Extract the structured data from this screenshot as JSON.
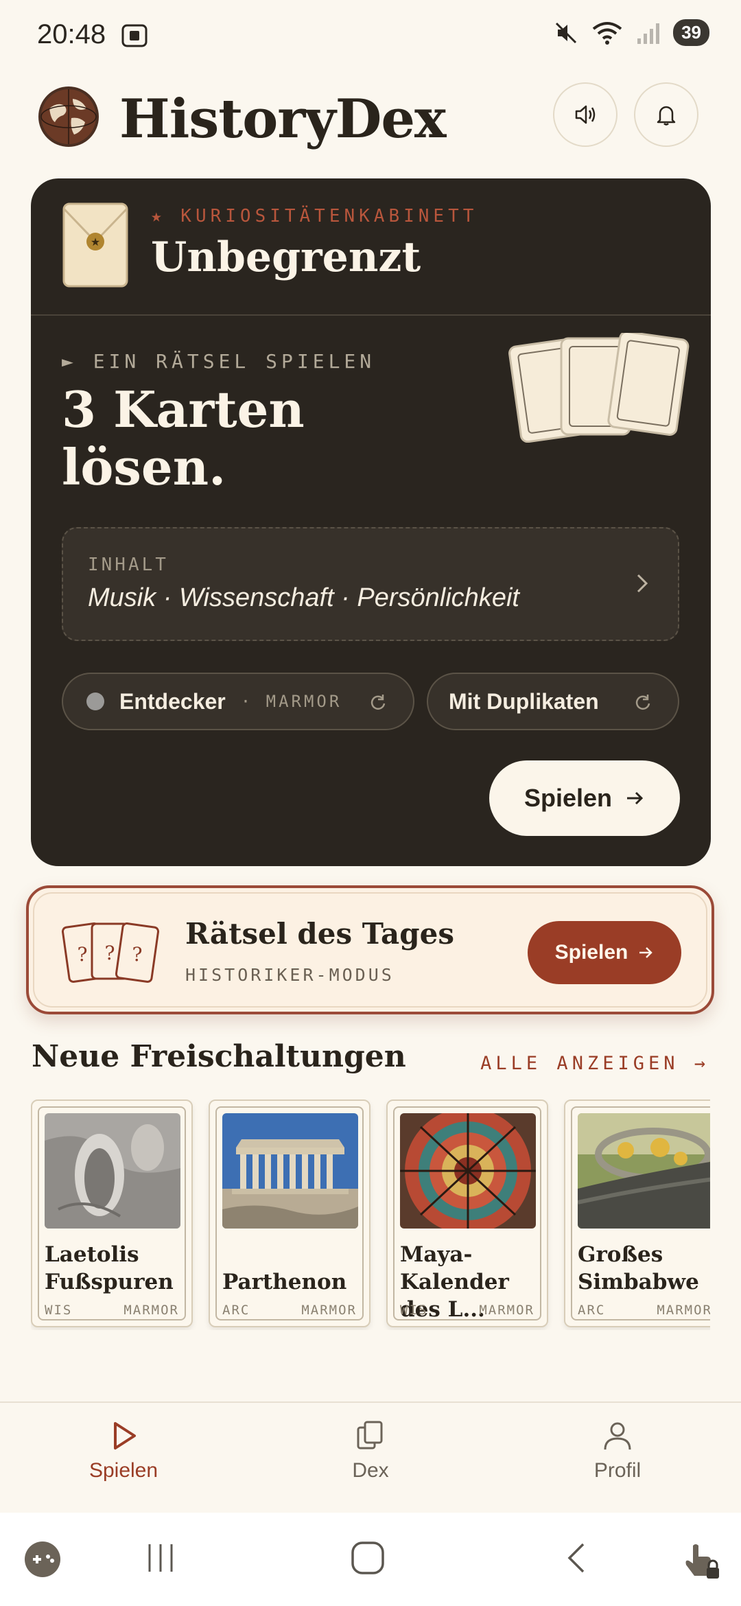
{
  "status_bar": {
    "time": "20:48",
    "battery": "39",
    "icons": [
      "screenshot-icon",
      "mute-icon",
      "wifi-icon",
      "signal-icon",
      "battery-icon"
    ]
  },
  "header": {
    "app_title": "HistoryDex",
    "icons": [
      "globe-logo",
      "speaker-icon",
      "bell-icon"
    ]
  },
  "mode_card": {
    "label": "★ KURIOSITÄTENKABINETT",
    "title": "Unbegrenzt",
    "play_hint": "► EIN RÄTSEL SPIELEN",
    "headline": "3 Karten lösen.",
    "content": {
      "label": "INHALT",
      "value": "Musik · Wissenschaft · Persönlichkeit"
    },
    "level_pill": {
      "label": "Entdecker",
      "sub": "· MARMOR"
    },
    "duplicates_pill": {
      "label": "Mit Duplikaten"
    },
    "play_button": "Spielen"
  },
  "daily_puzzle": {
    "title": "Rätsel des Tages",
    "subtitle": "HISTORIKER-MODUS",
    "button": "Spielen",
    "card_marks": [
      "?",
      "?",
      "?"
    ]
  },
  "unlocks": {
    "title": "Neue Freischaltungen",
    "link": "ALLE ANZEIGEN →",
    "items": [
      {
        "name": "Laetolis Fußspuren",
        "tag": "WIS",
        "rarity": "MARMOR"
      },
      {
        "name": "Parthenon",
        "tag": "ARC",
        "rarity": "MARMOR"
      },
      {
        "name": "Maya-Kalender des L...",
        "tag": "WIS",
        "rarity": "MARMOR"
      },
      {
        "name": "Großes Simbabwe",
        "tag": "ARC",
        "rarity": "MARMOR"
      }
    ]
  },
  "bottom_nav": {
    "items": [
      {
        "label": "Spielen",
        "icon": "play-icon",
        "active": true
      },
      {
        "label": "Dex",
        "icon": "cards-icon",
        "active": false
      },
      {
        "label": "Profil",
        "icon": "person-icon",
        "active": false
      }
    ]
  },
  "colors": {
    "accent": "#9a3d26",
    "dark_card": "#2a251f",
    "background": "#fbf7ef"
  }
}
